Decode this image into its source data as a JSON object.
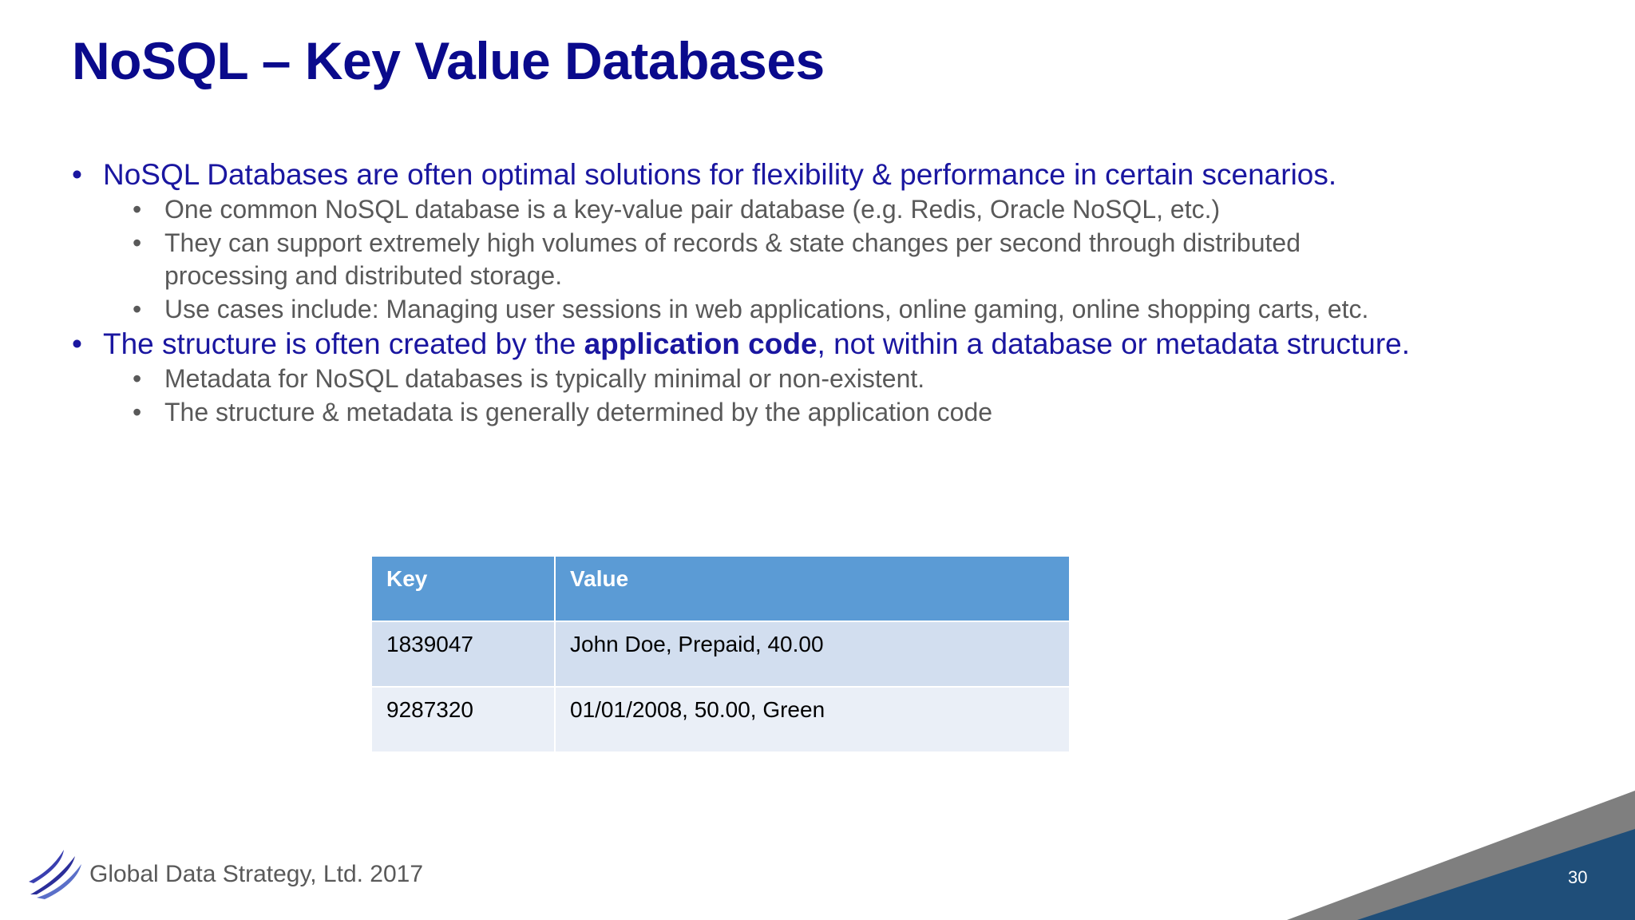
{
  "slide": {
    "title": "NoSQL – Key Value Databases",
    "bullets": [
      {
        "level": 1,
        "text": "NoSQL Databases are often optimal solutions for flexibility & performance in certain scenarios."
      },
      {
        "level": 2,
        "text": "One common NoSQL database is a key-value pair database (e.g. Redis, Oracle NoSQL, etc.)"
      },
      {
        "level": 2,
        "text": "They can support extremely high volumes of records & state changes per second through distributed processing and distributed storage."
      },
      {
        "level": 2,
        "text": "Use cases include: Managing user sessions in web applications, online gaming, online shopping carts, etc."
      },
      {
        "level": 1,
        "text_before": "The structure is often created by the ",
        "text_bold": "application code",
        "text_after": ", not within a database or metadata structure."
      },
      {
        "level": 2,
        "text": "Metadata for NoSQL databases is typically minimal or non-existent."
      },
      {
        "level": 2,
        "text": "The structure & metadata is generally determined by the application code"
      }
    ],
    "bullet_glyph": "•",
    "table": {
      "headers": [
        "Key",
        "Value"
      ],
      "rows": [
        [
          "1839047",
          "John Doe, Prepaid, 40.00"
        ],
        [
          "9287320",
          "01/01/2008, 50.00, Green"
        ]
      ]
    },
    "footer": {
      "company": "Global Data Strategy, Ltd. 2017",
      "page_number": "30"
    }
  },
  "colors": {
    "title": "#0a0a8c",
    "level1_text": "#1a16a0",
    "level2_text": "#595959",
    "table_header": "#5b9bd5",
    "table_row_1": "#d2deef",
    "table_row_2": "#eaeff7",
    "corner_dark": "#1f4e79",
    "corner_gray": "#7f7f7f"
  },
  "icons": {
    "logo": "swoosh-logo-icon"
  }
}
